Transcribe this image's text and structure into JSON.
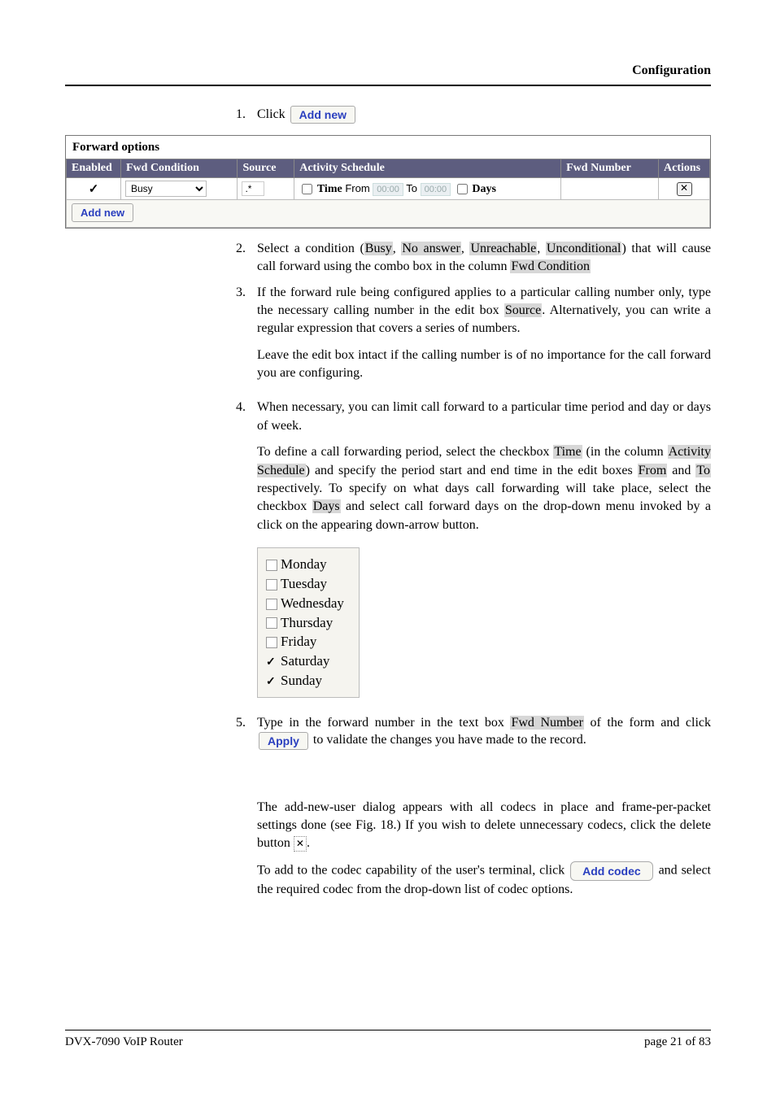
{
  "header": {
    "section": "Configuration"
  },
  "step1": {
    "num": "1.",
    "prefix": "Click",
    "btn": "Add new"
  },
  "forward_options": {
    "title": "Forward options",
    "cols": {
      "enabled": "Enabled",
      "fwd_condition": "Fwd Condition",
      "source": "Source",
      "activity": "Activity Schedule",
      "fwd_number": "Fwd Number",
      "actions": "Actions"
    },
    "row": {
      "enabled": true,
      "condition_value": "Busy",
      "source_value": ".*",
      "time_label": "Time",
      "from_label": "From",
      "from_value": "00:00",
      "to_label": "To",
      "to_value": "00:00",
      "days_label": "Days",
      "fwd_number_value": ""
    },
    "add_new_btn": "Add new"
  },
  "step2": {
    "num": "2.",
    "pre": "Select a condition (",
    "c1": "Busy",
    "c2": "No answer",
    "c3": "Unreachable",
    "c4": "Unconditional",
    "mid": ") that will cause call forward using the combo box in the column ",
    "col": "Fwd Condition"
  },
  "step3": {
    "num": "3.",
    "p1a": "If the forward rule being configured applies to a particular calling number only, type the necessary calling number in the edit box ",
    "p1b": "Source",
    "p1c": ". Alternatively, you can write a regular expression that covers a series of numbers.",
    "p2": "Leave the edit box intact if the calling number is of no importance for the call forward you are configuring."
  },
  "step4": {
    "num": "4.",
    "p1": "When necessary, you can limit call forward to a particular time period and day or days of week.",
    "p2a": "To define a call forwarding period, select the checkbox ",
    "t_time": "Time",
    "p2b": "  (in the column ",
    "t_act": "Activity Schedule",
    "p2c": ") and specify the period start and end time in the edit boxes ",
    "t_from": "From",
    "p2d": " and ",
    "t_to": "To",
    "p2e": " respectively. To specify on what days call forwarding will take place, select the checkbox ",
    "t_days": "Days",
    "p2f": " and select call forward days on the drop-down menu invoked by a click on the appearing down-arrow button."
  },
  "days": {
    "mon": "Monday",
    "tue": "Tuesday",
    "wed": "Wednesday",
    "thu": "Thursday",
    "fri": "Friday",
    "sat": "Saturday",
    "sun": "Sunday"
  },
  "step5": {
    "num": "5.",
    "p1a": "Type in the forward number in the text box ",
    "t_fwd": "Fwd Number",
    "p1b": " of the form and click ",
    "btn": "Apply",
    "p1c": " to validate the changes you have made to the record."
  },
  "codec": {
    "p1a": "The add-new-user dialog appears with all codecs in place and frame-per-packet settings done (see Fig. 18.) If you wish to delete unnecessary codecs, click the delete button ",
    "del_icon": "✕",
    "p1b": ".",
    "p2a": "To add to the codec capability of the user's terminal, click ",
    "btn": "Add codec",
    "p2b": " and select the required codec from the drop-down list of codec options."
  },
  "footer": {
    "left": "DVX-7090 VoIP Router",
    "right": "page 21 of 83"
  }
}
